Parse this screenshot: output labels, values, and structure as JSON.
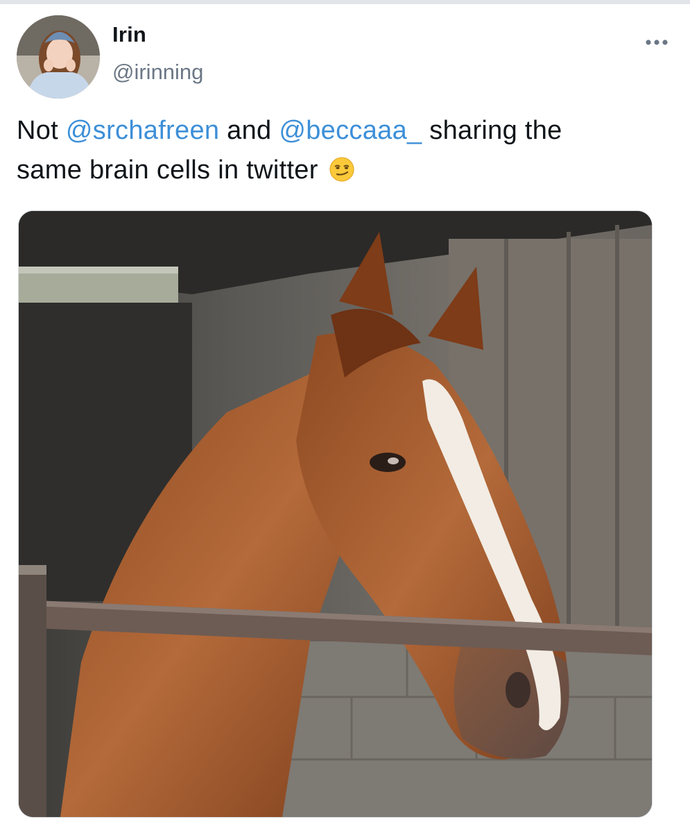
{
  "tweet": {
    "display_name": "Irin",
    "handle": "@irinning",
    "more_icon": "more-horizontal-icon",
    "text": {
      "prefix": "Not ",
      "mention_1": "@srchafreen",
      "middle": " and ",
      "mention_2": "@beccaaa_",
      "line_1_rest": " sharing the",
      "line_2": "same brain cells in twitter",
      "emoji": "smirking-face-emoji"
    },
    "colors": {
      "mention": "#3d8fd8",
      "text": "#0f1419",
      "handle": "#6b7785"
    }
  }
}
